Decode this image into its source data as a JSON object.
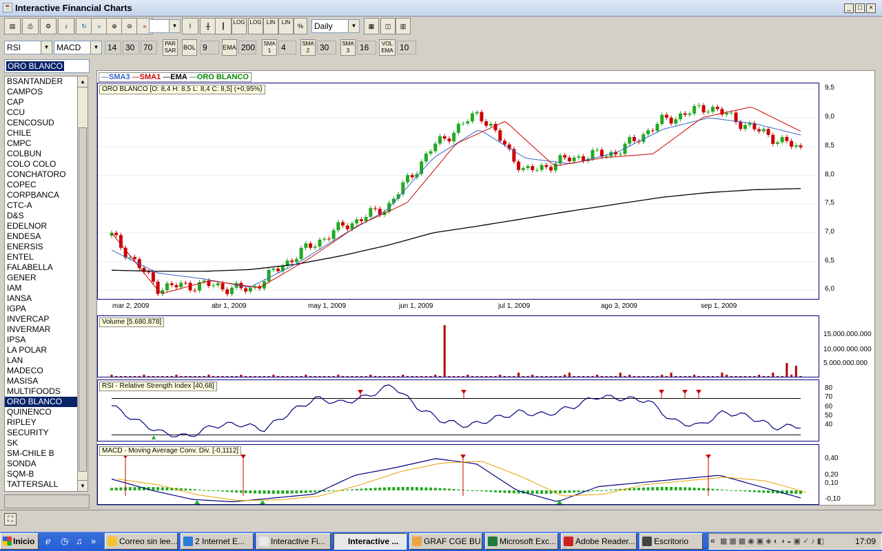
{
  "window": {
    "title": "Interactive Financial Charts"
  },
  "toolbar1": {
    "log1": "LOG",
    "log2": "LOG",
    "lin1": "LIN",
    "lin2": "LIN",
    "pct": "%",
    "period": "Daily"
  },
  "toolbar2": {
    "ind1": "RSI",
    "ind2": "MACD",
    "p1": "14",
    "p2": "30",
    "p3": "70",
    "parsar": "PAR SAR",
    "bol": "BOL",
    "bolv": "9",
    "ema": "EMA",
    "emav": "200",
    "sma1": "SMA 1",
    "sma1v": "4",
    "sma2": "SMA 2",
    "sma2v": "30",
    "sma3": "SMA 3",
    "sma3v": "16",
    "volema": "VOL EMA",
    "volemav": "10"
  },
  "sidebar": {
    "search": "ORO BLANCO",
    "items": [
      "BSANTANDER",
      "CAMPOS",
      "CAP",
      "CCU",
      "CENCOSUD",
      "CHILE",
      "CMPC",
      "COLBUN",
      "COLO COLO",
      "CONCHATORO",
      "COPEC",
      "CORPBANCA",
      "CTC-A",
      "D&S",
      "EDELNOR",
      "ENDESA",
      "ENERSIS",
      "ENTEL",
      "FALABELLA",
      "GENER",
      "IAM",
      "IANSA",
      "IGPA",
      "INVERCAP",
      "INVERMAR",
      "IPSA",
      "LA POLAR",
      "LAN",
      "MADECO",
      "MASISA",
      "MULTIFOODS",
      "ORO BLANCO",
      "QUINENCO",
      "RIPLEY",
      "SECURITY",
      "SK",
      "SM-CHILE B",
      "SONDA",
      "SQM-B",
      "TATTERSALL"
    ],
    "selected": "ORO BLANCO"
  },
  "legend": {
    "sma3": "SMA3",
    "sma1": "SMA1",
    "ema": "EMA",
    "sym": "ORO BLANCO"
  },
  "colors": {
    "sma3": "#3366cc",
    "sma1": "#cc0000",
    "ema": "#000000",
    "sym": "#008800",
    "up": "#22aa22",
    "down": "#cc0000"
  },
  "price_info": "ORO BLANCO [O: 8,4  H: 8,5  L: 8,4  C: 8,5] (+0,95%)",
  "volume_info": "Volume [5.680.878]",
  "rsi_info": "RSI - Relative Strength Index [40,68]",
  "macd_info": "MACD - Moving Average Conv. Div. [-0,1112]",
  "price_axis": [
    "9,5",
    "9,0",
    "8,5",
    "8,0",
    "7,5",
    "7,0",
    "6,5",
    "6,0"
  ],
  "date_axis": [
    "mar 2, 2009",
    "abr 1, 2009",
    "may 1, 2009",
    "jun 1, 2009",
    "jul 1, 2009",
    "ago 3, 2009",
    "sep 1, 2009"
  ],
  "volume_axis": [
    "15.000.000.000",
    "10.000.000.000",
    "5.000.000.000"
  ],
  "rsi_axis": [
    "80",
    "70",
    "60",
    "50",
    "40"
  ],
  "macd_axis": [
    "0,40",
    "0,20",
    "0,10",
    "-0,10"
  ],
  "taskbar": {
    "start": "Inicio",
    "tasks": [
      "Correo sin lee...",
      "2 Internet E...",
      "Interactive Fi...",
      "Interactive ...",
      "GRAF CGE BU...",
      "Microsoft Exc...",
      "Adobe Reader...",
      "Escritorio"
    ],
    "active": 3,
    "clock": "17:09"
  },
  "chart_data": {
    "type": "line",
    "title": "ORO BLANCO",
    "x": [
      "mar 2, 2009",
      "abr 1, 2009",
      "may 1, 2009",
      "jun 1, 2009",
      "jul 1, 2009",
      "ago 3, 2009",
      "sep 1, 2009"
    ],
    "ylim": [
      5.85,
      9.6
    ],
    "series": [
      {
        "name": "ORO BLANCO",
        "values": [
          6.95,
          6.05,
          6.1,
          6.0,
          6.6,
          7.1,
          7.45,
          8.5,
          9.1,
          8.05,
          8.3,
          8.4,
          8.95,
          9.2,
          8.8,
          8.45
        ]
      },
      {
        "name": "SMA3",
        "values": [
          6.7,
          6.3,
          6.2,
          6.05,
          6.45,
          6.95,
          7.4,
          8.3,
          8.8,
          8.3,
          8.2,
          8.4,
          8.8,
          9.0,
          8.9,
          8.7
        ]
      },
      {
        "name": "EMA",
        "values": [
          6.35,
          6.33,
          6.33,
          6.36,
          6.45,
          6.6,
          6.78,
          7.0,
          7.12,
          7.25,
          7.38,
          7.5,
          7.62,
          7.7,
          7.75,
          7.77
        ]
      }
    ]
  }
}
